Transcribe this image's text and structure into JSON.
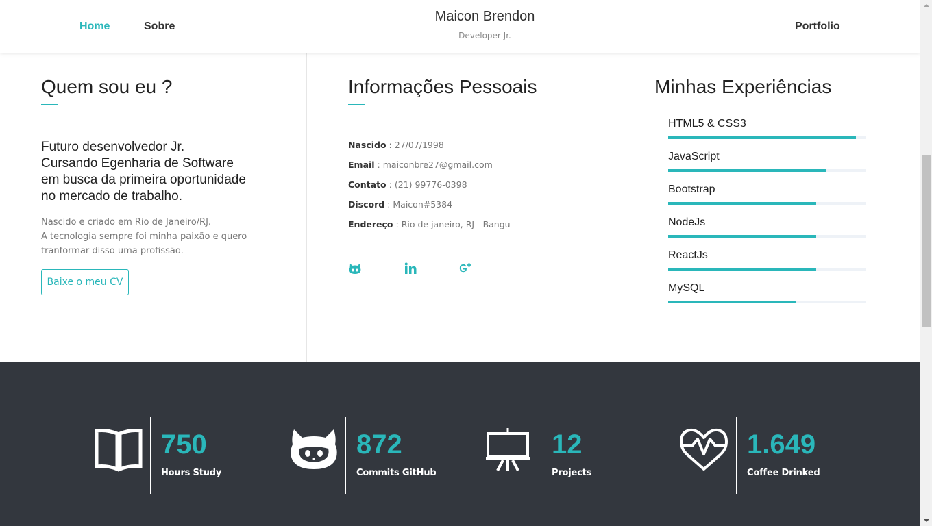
{
  "nav": {
    "home": "Home",
    "sobre": "Sobre",
    "portfolio": "Portfolio",
    "active_color": "#2ab7ba"
  },
  "brand": {
    "name": "Maicon Brendon",
    "subtitle": "Developer Jr."
  },
  "about": {
    "title": "Quem sou eu ?",
    "lead": [
      "Futuro desenvolvedor Jr.",
      "Cursando Egenharia de Software",
      "em busca da primeira oportunidade",
      "no mercado de trabalho."
    ],
    "description": [
      "Nascido e criado em Rio de Janeiro/RJ.",
      "A tecnologia sempre foi minha paixão e quero",
      "tranformar disso uma profissão."
    ],
    "cv_button": "Baixe o meu CV"
  },
  "info": {
    "title": "Informações Pessoais",
    "rows": [
      {
        "label": "Nascido",
        "value": "27/07/1998"
      },
      {
        "label": "Email",
        "value": "maiconbre27@gmail.com"
      },
      {
        "label": "Contato",
        "value": "(21) 99776-0398"
      },
      {
        "label": "Discord",
        "value": "Maicon#5384"
      },
      {
        "label": "Endereço",
        "value": "Rio de janeiro, RJ - Bangu"
      }
    ],
    "social_icons": [
      "github-icon",
      "linkedin-icon",
      "google-plus-icon"
    ]
  },
  "skills": {
    "title": "Minhas Experiências",
    "items": [
      {
        "name": "HTML5 & CSS3",
        "level": 0.95
      },
      {
        "name": "JavaScript",
        "level": 0.8
      },
      {
        "name": "Bootstrap",
        "level": 0.75
      },
      {
        "name": "NodeJs",
        "level": 0.75
      },
      {
        "name": "ReactJs",
        "level": 0.75
      },
      {
        "name": "MySQL",
        "level": 0.65
      }
    ]
  },
  "stats": [
    {
      "icon": "book-icon",
      "value": "750",
      "label": "Hours Study"
    },
    {
      "icon": "github-icon",
      "value": "872",
      "label": "Commits GitHub"
    },
    {
      "icon": "easel-icon",
      "value": "12",
      "label": "Projects"
    },
    {
      "icon": "heart-pulse-icon",
      "value": "1.649",
      "label": "Coffee Drinked"
    }
  ],
  "colors": {
    "accent": "#2ab7ba",
    "dark_section": "#33373e"
  }
}
